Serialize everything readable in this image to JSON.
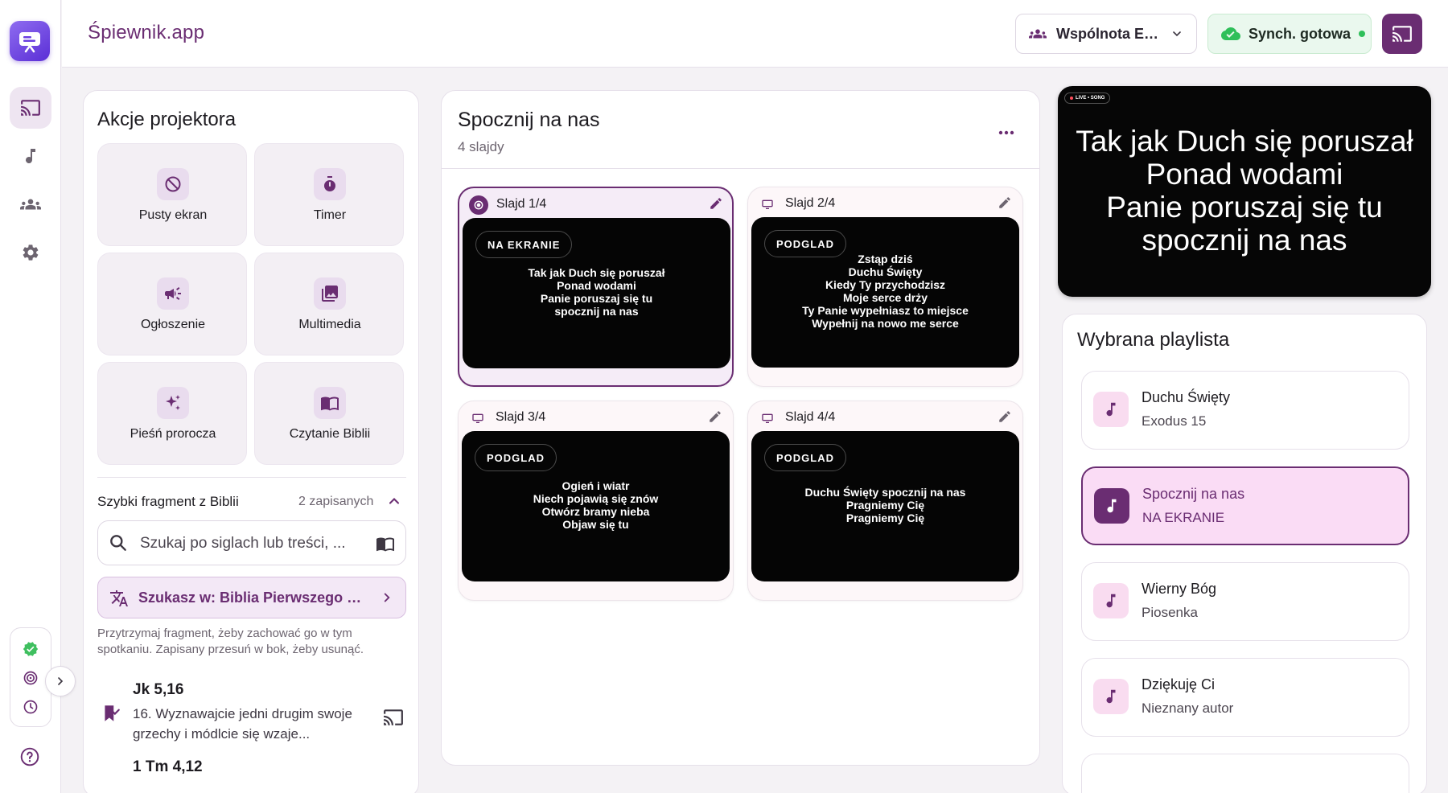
{
  "app": {
    "title": "Śpiewnik.app"
  },
  "header": {
    "community": "Wspólnota EF...",
    "sync_label": "Synch. gotowa"
  },
  "colors": {
    "primary": "#6a2d72",
    "sync_green": "#2fbf5a",
    "slide_bg": "#050505"
  },
  "rail": {
    "items": [
      {
        "icon": "cast-icon",
        "active": true
      },
      {
        "icon": "music-note-icon",
        "active": false
      },
      {
        "icon": "people-icon",
        "active": false
      },
      {
        "icon": "gear-icon",
        "active": false
      }
    ],
    "status_icons": [
      "verified-check-icon",
      "target-icon",
      "clock-icon"
    ],
    "help_icon": "help-icon"
  },
  "actions": {
    "title": "Akcje projektora",
    "items": [
      {
        "label": "Pusty ekran",
        "icon": "blank-screen-icon"
      },
      {
        "label": "Timer",
        "icon": "timer-icon"
      },
      {
        "label": "Ogłoszenie",
        "icon": "megaphone-icon"
      },
      {
        "label": "Multimedia",
        "icon": "image-icon"
      },
      {
        "label": "Pieśń prorocza",
        "icon": "sparkle-icon"
      },
      {
        "label": "Czytanie Biblii",
        "icon": "book-icon"
      }
    ]
  },
  "quick_bible": {
    "title": "Szybki fragment z Biblii",
    "saved_count": "2 zapisanych",
    "search_placeholder": "Szukaj po siglach lub treści, ...",
    "bible_selector": "Szukasz w: Biblia Pierwszego Ko...",
    "hint": "Przytrzymaj fragment, żeby zachować go w tym spotkaniu. Zapisany przesuń w bok, żeby usunąć.",
    "verses": [
      {
        "ref": "Jk 5,16",
        "text": "16. Wyznawajcie jedni drugim swoje grzechy i módlcie się wzaje..."
      },
      {
        "ref": "1 Tm 4,12",
        "text": ""
      }
    ]
  },
  "song": {
    "title": "Spocznij na nas",
    "subtitle": "4 slajdy",
    "slides": [
      {
        "label": "Slajd 1/4",
        "chip": "NA EKRANIE",
        "live": true,
        "lyrics": "Tak jak Duch się poruszał\nPonad wodami\nPanie poruszaj się tu\nspocznij na nas"
      },
      {
        "label": "Slajd 2/4",
        "chip": "PODGLAD",
        "live": false,
        "lyrics": "Zstąp dziś\nDuchu Święty\nKiedy Ty przychodzisz\nMoje serce drży\nTy Panie wypełniasz to miejsce\nWypełnij na nowo me serce"
      },
      {
        "label": "Slajd 3/4",
        "chip": "PODGLAD",
        "live": false,
        "lyrics": "Ogień i wiatr\nNiech pojawią się znów\nOtwórz bramy nieba\nObjaw się tu"
      },
      {
        "label": "Slajd 4/4",
        "chip": "PODGLAD",
        "live": false,
        "lyrics": "Duchu Święty spocznij na nas\nPragniemy Cię\nPragniemy Cię"
      }
    ]
  },
  "live_preview": {
    "badge": "LIVE • SONG",
    "text": "Tak jak Duch się poruszał\nPonad wodami\nPanie poruszaj się tu\nspocznij na nas"
  },
  "playlist": {
    "title": "Wybrana playlista",
    "items": [
      {
        "name": "Duchu Święty",
        "sub": "Exodus 15",
        "active": false
      },
      {
        "name": "Spocznij na nas",
        "sub": "NA EKRANIE",
        "active": true
      },
      {
        "name": "Wierny Bóg",
        "sub": "Piosenka",
        "active": false
      },
      {
        "name": "Dziękuję Ci",
        "sub": "Nieznany autor",
        "active": false
      }
    ]
  }
}
